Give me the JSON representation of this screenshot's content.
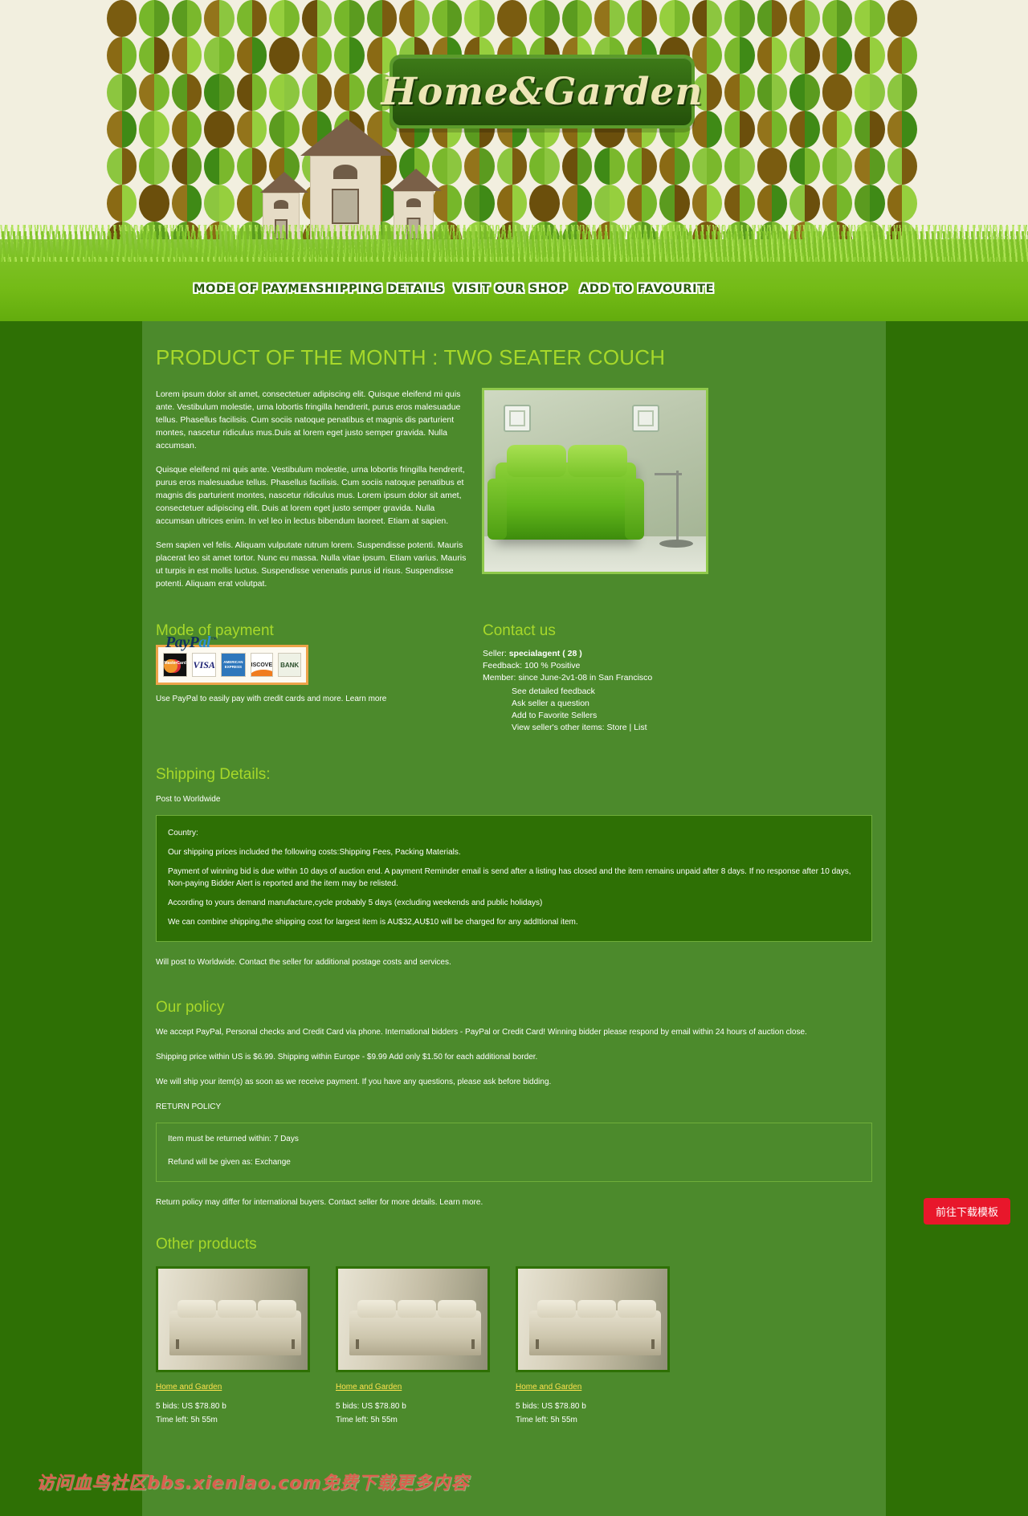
{
  "brand": {
    "logo_text": "Home&Garden"
  },
  "nav": {
    "items": [
      {
        "label": "MODE OF PAYMENT"
      },
      {
        "label": "SHIPPING DETAILS"
      },
      {
        "label": "VISIT OUR SHOP"
      },
      {
        "label": "ADD TO FAVOURITE"
      }
    ]
  },
  "main": {
    "title": "PRODUCT OF THE MONTH : TWO SEATER COUCH",
    "paragraphs": [
      "Lorem ipsum dolor sit amet, consectetuer adipiscing elit. Quisque eleifend mi quis ante. Vestibulum molestie, urna lobortis fringilla hendrerit, purus eros malesuadue tellus. Phasellus facilisis. Cum sociis natoque penatibus et magnis dis parturient montes, nascetur ridiculus mus.Duis at lorem eget justo semper gravida. Nulla accumsan.",
      "Quisque eleifend mi quis ante. Vestibulum molestie, urna lobortis fringilla hendrerit, purus eros malesuadue tellus. Phasellus facilisis. Cum sociis natoque penatibus et magnis dis parturient montes, nascetur ridiculus mus. Lorem ipsum dolor sit amet, consectetuer adipiscing elit. Duis at lorem eget justo semper gravida. Nulla accumsan ultrices enim. In vel leo in lectus bibendum laoreet. Etiam at sapien.",
      "Sem sapien vel felis. Aliquam vulputate rutrum lorem. Suspendisse potenti. Mauris placerat leo sit amet tortor. Nunc eu massa. Nulla vitae ipsum. Etiam varius. Mauris ut turpis in est mollis luctus. Suspendisse venenatis purus id risus. Suspendisse potenti. Aliquam erat volutpat."
    ]
  },
  "payment": {
    "heading": "Mode of payment",
    "paypal_part1": "PayP",
    "paypal_part2": "al",
    "paypal_tm": "™",
    "cards": [
      {
        "label": "MasterCard"
      },
      {
        "label": "VISA"
      },
      {
        "label": "AMERICAN EXPRESS"
      },
      {
        "label": "DISCOVER"
      },
      {
        "label": "BANK"
      }
    ],
    "note": "Use PayPal to easily pay with credit cards and more. Learn more"
  },
  "contact": {
    "heading": "Contact us",
    "seller_label": "Seller:",
    "seller_name": "specialagent ( 28 )",
    "feedback": "Feedback: 100 % Positive",
    "member": "Member: since June-2v1-08 in San Francisco",
    "links": [
      {
        "label": "See detailed feedback"
      },
      {
        "label": "Ask seller a question"
      },
      {
        "label": "Add to Favorite Sellers"
      },
      {
        "label": "View seller's other items: Store | List"
      }
    ]
  },
  "shipping": {
    "heading": "Shipping Details:",
    "post_to": "Post to Worldwide",
    "box": [
      "Country:",
      "Our shipping prices included the following costs:Shipping Fees, Packing Materials.",
      "Payment of winning bid is due within 10 days of auction end. A payment Reminder email is send after a listing has closed and the item remains unpaid after 8 days. If no response after 10 days, Non-paying Bidder Alert is reported and the item may be relisted.",
      "According to yours demand manufacture,cycle probably 5 days (excluding weekends and public holidays)",
      "We can combine shipping,the shipping cost for largest item is AU$32,AU$10 will be charged for any addItional item."
    ],
    "footer": "Will post to Worldwide. Contact the seller for additional postage costs and services."
  },
  "policy": {
    "heading": "Our policy",
    "paragraphs": [
      "We accept PayPal, Personal checks and Credit Card via phone. International bidders - PayPal or Credit Card! Winning bidder please respond by email within 24 hours of auction close.",
      "Shipping price within US is $6.99. Shipping within Europe - $9.99 Add only $1.50 for each additional border.",
      "We will ship your item(s) as soon as we receive payment. If you have any questions, please ask before bidding."
    ],
    "return_title": "RETURN POLICY",
    "return_items": [
      "Item must be returned within: 7 Days",
      "Refund will be given as: Exchange"
    ],
    "return_footer": "Return policy may differ for international buyers. Contact seller for more details. Learn more."
  },
  "other_products": {
    "heading": "Other products",
    "items": [
      {
        "link": "Home and Garden",
        "bids": "5 bids: US $78.80 b",
        "time": "Time left: 5h 55m"
      },
      {
        "link": "Home and Garden",
        "bids": "5 bids: US $78.80 b",
        "time": "Time left: 5h 55m"
      },
      {
        "link": "Home and Garden",
        "bids": "5 bids: US $78.80 b",
        "time": "Time left: 5h 55m"
      }
    ]
  },
  "watermark": {
    "text": "访问血鸟社区bbs.xienlao.com免费下载更多内容"
  },
  "download_button": {
    "label": "前往下载模板"
  },
  "colors": {
    "page_bg": "#2e7005",
    "content_bg": "#4c8a2c",
    "accent_green": "#a7d82a",
    "link_yellow": "#ffe24d",
    "header_cream": "#f2efdf",
    "grass": "#74bb17",
    "button_red": "#e8172b"
  }
}
